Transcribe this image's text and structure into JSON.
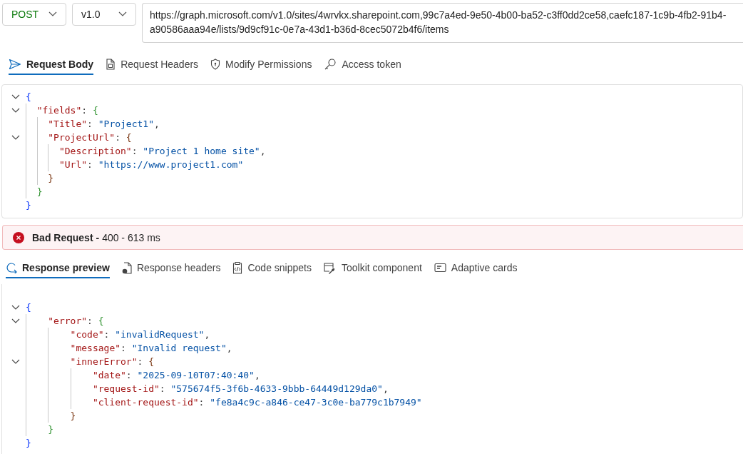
{
  "method": {
    "value": "POST"
  },
  "version": {
    "value": "v1.0"
  },
  "url": {
    "value": "https://graph.microsoft.com/v1.0/sites/4wrvkx.sharepoint.com,99c7a4ed-9e50-4b00-ba52-c3ff0dd2ce58,caefc187-1c9b-4fb2-91b4-a90586aaa94e/lists/9d9cf91c-0e7a-43d1-b36d-8cec5072b4f6/items"
  },
  "request_tabs": [
    {
      "label": "Request Body",
      "selected": true,
      "kind": "send"
    },
    {
      "label": "Request Headers",
      "selected": false,
      "kind": "doc"
    },
    {
      "label": "Modify Permissions",
      "selected": false,
      "kind": "shield"
    },
    {
      "label": "Access token",
      "selected": false,
      "kind": "key"
    }
  ],
  "request_body": [
    {
      "foldable": true,
      "tokens": [
        {
          "kind": "bracket1",
          "text": "{"
        }
      ]
    },
    {
      "foldable": true,
      "tokens": [
        {
          "kind": "key",
          "text": "\"fields\""
        },
        {
          "kind": "punct",
          "text": ": "
        },
        {
          "kind": "bracket2",
          "text": "{"
        }
      ]
    },
    {
      "foldable": false,
      "tokens": [
        {
          "kind": "key",
          "text": "\"Title\""
        },
        {
          "kind": "punct",
          "text": ": "
        },
        {
          "kind": "string",
          "text": "\"Project1\""
        },
        {
          "kind": "punct",
          "text": ","
        }
      ]
    },
    {
      "foldable": true,
      "tokens": [
        {
          "kind": "key",
          "text": "\"ProjectUrl\""
        },
        {
          "kind": "punct",
          "text": ": "
        },
        {
          "kind": "bracket3",
          "text": "{"
        }
      ]
    },
    {
      "foldable": false,
      "tokens": [
        {
          "kind": "key",
          "text": "\"Description\""
        },
        {
          "kind": "punct",
          "text": ": "
        },
        {
          "kind": "string",
          "text": "\"Project 1 home site\""
        },
        {
          "kind": "punct",
          "text": ","
        }
      ]
    },
    {
      "foldable": false,
      "tokens": [
        {
          "kind": "key",
          "text": "\"Url\""
        },
        {
          "kind": "punct",
          "text": ": "
        },
        {
          "kind": "string",
          "text": "\"https://www.project1.com\""
        }
      ]
    },
    {
      "foldable": false,
      "tokens": [
        {
          "kind": "bracket3",
          "text": "}"
        }
      ]
    },
    {
      "foldable": false,
      "tokens": [
        {
          "kind": "bracket2",
          "text": "}"
        }
      ]
    },
    {
      "foldable": false,
      "tokens": [
        {
          "kind": "bracket1",
          "text": "}"
        }
      ]
    }
  ],
  "status": {
    "title": "Bad Request -",
    "detail": "400 - 613 ms"
  },
  "response_tabs": [
    {
      "label": "Response preview",
      "selected": true,
      "kind": "preview"
    },
    {
      "label": "Response headers",
      "selected": false,
      "kind": "doc"
    },
    {
      "label": "Code snippets",
      "selected": false,
      "kind": "code"
    },
    {
      "label": "Toolkit component",
      "selected": false,
      "kind": "wrench"
    },
    {
      "label": "Adaptive cards",
      "selected": false,
      "kind": "card"
    }
  ],
  "response_body": [
    {
      "foldable": true,
      "tokens": [
        {
          "kind": "bracket1",
          "text": "{"
        }
      ]
    },
    {
      "foldable": true,
      "tokens": [
        {
          "kind": "key",
          "text": "\"error\""
        },
        {
          "kind": "punct",
          "text": ": "
        },
        {
          "kind": "bracket2",
          "text": "{"
        }
      ]
    },
    {
      "foldable": false,
      "tokens": [
        {
          "kind": "key",
          "text": "\"code\""
        },
        {
          "kind": "punct",
          "text": ": "
        },
        {
          "kind": "string",
          "text": "\"invalidRequest\""
        },
        {
          "kind": "punct",
          "text": ","
        }
      ]
    },
    {
      "foldable": false,
      "tokens": [
        {
          "kind": "key",
          "text": "\"message\""
        },
        {
          "kind": "punct",
          "text": ": "
        },
        {
          "kind": "string",
          "text": "\"Invalid request\""
        },
        {
          "kind": "punct",
          "text": ","
        }
      ]
    },
    {
      "foldable": true,
      "tokens": [
        {
          "kind": "key",
          "text": "\"innerError\""
        },
        {
          "kind": "punct",
          "text": ": "
        },
        {
          "kind": "bracket3",
          "text": "{"
        }
      ]
    },
    {
      "foldable": false,
      "tokens": [
        {
          "kind": "key",
          "text": "\"date\""
        },
        {
          "kind": "punct",
          "text": ": "
        },
        {
          "kind": "string",
          "text": "\"2025-09-10T07:40:40\""
        },
        {
          "kind": "punct",
          "text": ","
        }
      ]
    },
    {
      "foldable": false,
      "tokens": [
        {
          "kind": "key",
          "text": "\"request-id\""
        },
        {
          "kind": "punct",
          "text": ": "
        },
        {
          "kind": "string",
          "text": "\"575674f5-3f6b-4633-9bbb-64449d129da0\""
        },
        {
          "kind": "punct",
          "text": ","
        }
      ]
    },
    {
      "foldable": false,
      "tokens": [
        {
          "kind": "key",
          "text": "\"client-request-id\""
        },
        {
          "kind": "punct",
          "text": ": "
        },
        {
          "kind": "string",
          "text": "\"fe8a4c9c-a846-ce47-3c0e-ba779c1b7949\""
        }
      ]
    },
    {
      "foldable": false,
      "tokens": [
        {
          "kind": "bracket3",
          "text": "}"
        }
      ]
    },
    {
      "foldable": false,
      "tokens": [
        {
          "kind": "bracket2",
          "text": "}"
        }
      ]
    },
    {
      "foldable": false,
      "tokens": [
        {
          "kind": "bracket1",
          "text": "}"
        }
      ]
    }
  ]
}
